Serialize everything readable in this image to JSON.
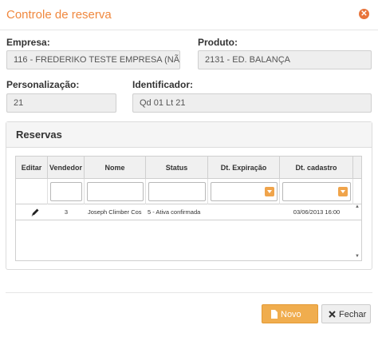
{
  "dialog": {
    "title": "Controle de reserva",
    "close_glyph": "✕"
  },
  "form": {
    "empresa_label": "Empresa:",
    "empresa_value": "116 - FREDERIKO TESTE  EMPRESA (NÃO",
    "produto_label": "Produto:",
    "produto_value": "2131 - ED. BALANÇA",
    "personalizacao_label": "Personalização:",
    "personalizacao_value": "21",
    "identificador_label": "Identificador:",
    "identificador_value": "Qd 01 Lt 21"
  },
  "reservas": {
    "title": "Reservas",
    "columns": [
      "Editar",
      "Vendedor",
      "Nome",
      "Status",
      "Dt. Expiração",
      "Dt. cadastro"
    ],
    "rows": [
      {
        "vendedor": "3",
        "nome": "Joseph Climber Cos",
        "status": "5 - Ativa confirmada",
        "dt_expiracao": "",
        "dt_cadastro": "03/06/2013 16:00"
      }
    ]
  },
  "icons": {
    "edit": "pencil-icon",
    "close": "close-icon",
    "novo": "document-icon",
    "fechar": "close-x-icon"
  },
  "colors": {
    "accent": "#f0883e",
    "button_primary": "#f0ad4e"
  },
  "footer": {
    "novo_label": "Novo",
    "fechar_label": "Fechar"
  }
}
